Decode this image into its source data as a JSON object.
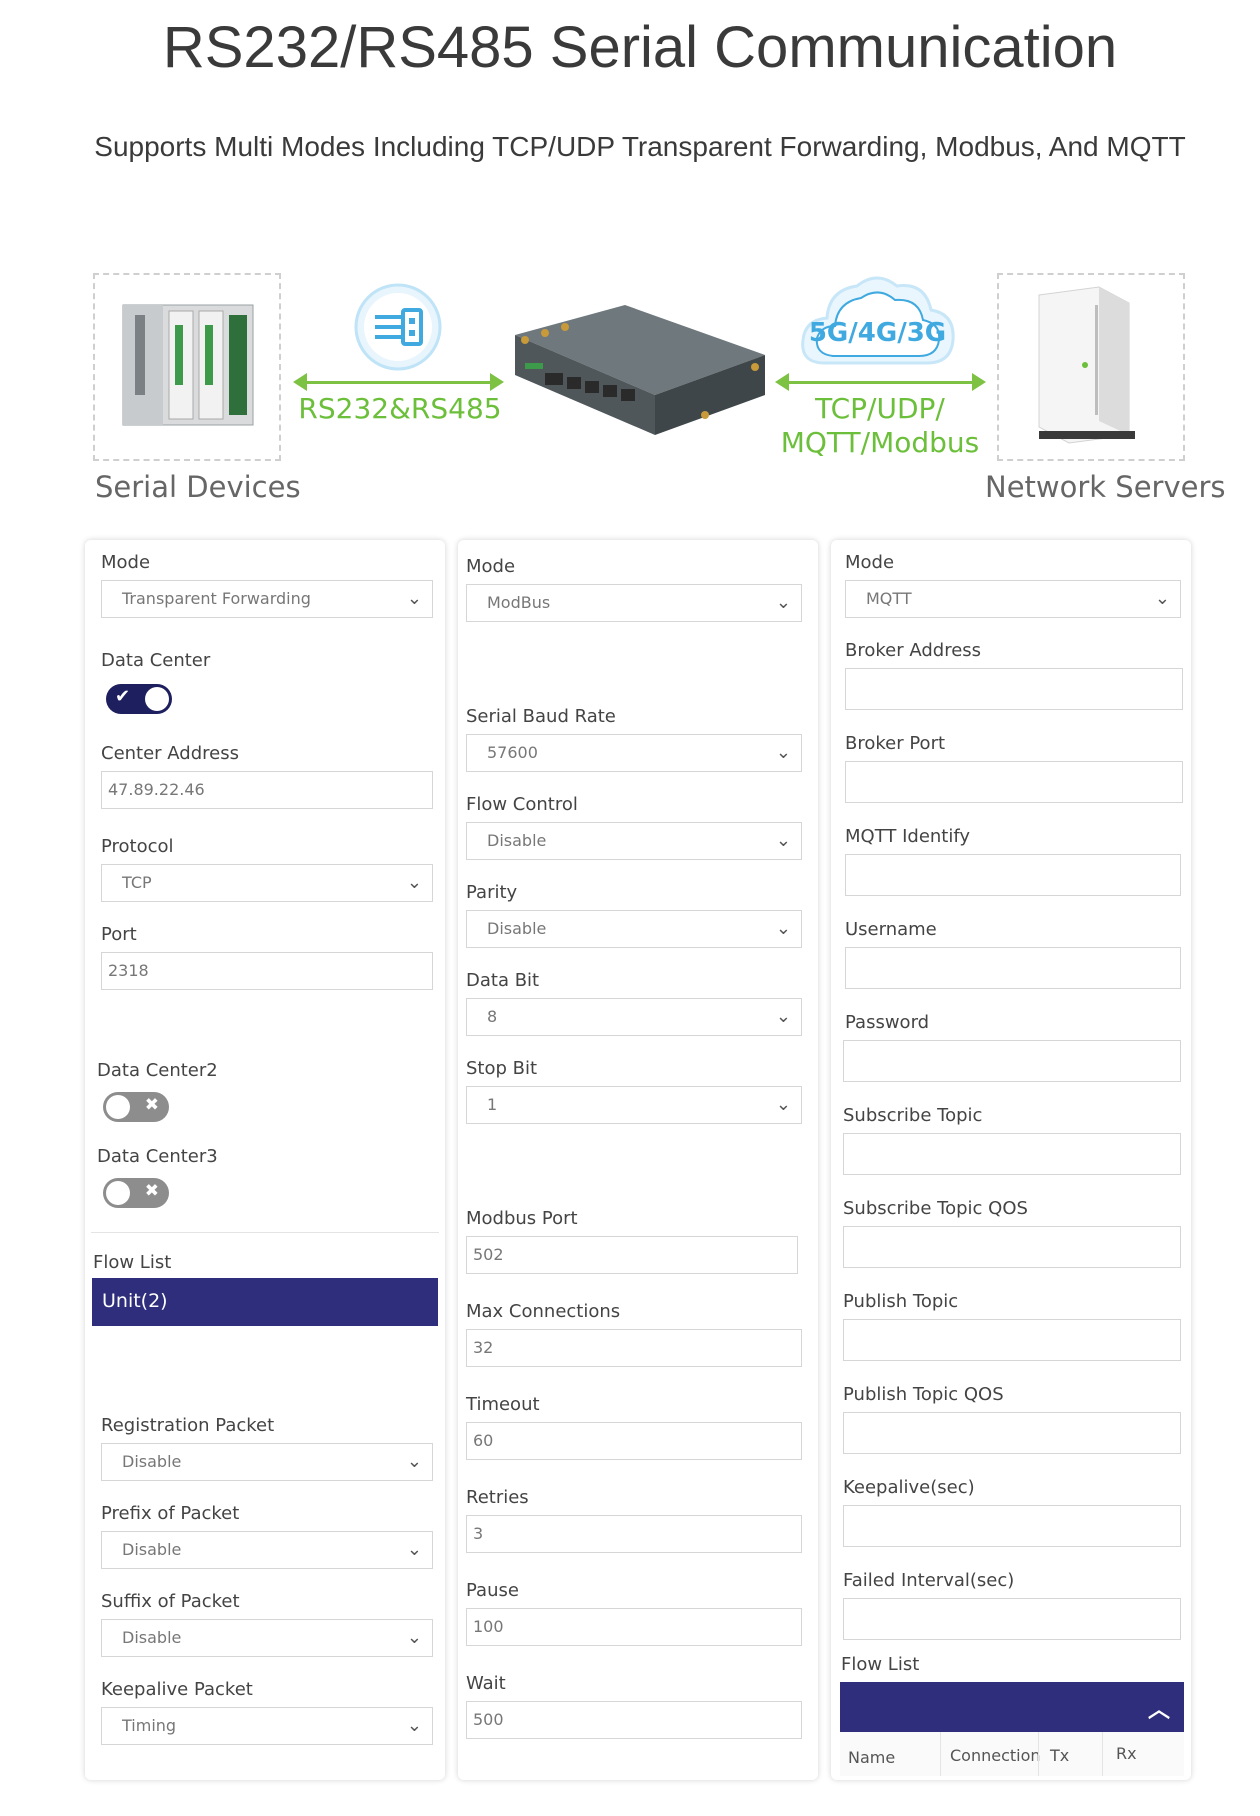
{
  "header": {
    "title": "RS232/RS485 Serial Communication",
    "subtitle": "Supports Multi Modes Including TCP/UDP Transparent Forwarding, Modbus, And MQTT"
  },
  "diagram": {
    "left_label": "Serial Devices",
    "right_label": "Network Servers",
    "left_link": "RS232&RS485",
    "cloud_label": "5G/4G/3G",
    "right_link_line1": "TCP/UDP/",
    "right_link_line2": "MQTT/Modbus",
    "colors": {
      "green": "#7dc243",
      "blue": "#3fa9e0",
      "navy": "#2e2e7c"
    }
  },
  "panel1": {
    "mode_label": "Mode",
    "mode_value": "Transparent Forwarding",
    "data_center_label": "Data Center",
    "center_address_label": "Center Address",
    "center_address_value": "47.89.22.46",
    "protocol_label": "Protocol",
    "protocol_value": "TCP",
    "port_label": "Port",
    "port_value": "2318",
    "data_center2_label": "Data Center2",
    "data_center3_label": "Data Center3",
    "flow_list_label": "Flow List",
    "unit_label": "Unit(2)",
    "registration_label": "Registration Packet",
    "registration_value": "Disable",
    "prefix_label": "Prefix of Packet",
    "prefix_value": "Disable",
    "suffix_label": "Suffix of Packet",
    "suffix_value": "Disable",
    "keepalive_label": "Keepalive Packet",
    "keepalive_value": "Timing"
  },
  "panel2": {
    "mode_label": "Mode",
    "mode_value": "ModBus",
    "baud_label": "Serial Baud Rate",
    "baud_value": "57600",
    "flow_label": "Flow Control",
    "flow_value": "Disable",
    "parity_label": "Parity",
    "parity_value": "Disable",
    "databit_label": "Data Bit",
    "databit_value": "8",
    "stopbit_label": "Stop Bit",
    "stopbit_value": "1",
    "modbus_port_label": "Modbus Port",
    "modbus_port_value": "502",
    "max_conn_label": "Max Connections",
    "max_conn_value": "32",
    "timeout_label": "Timeout",
    "timeout_value": "60",
    "retries_label": "Retries",
    "retries_value": "3",
    "pause_label": "Pause",
    "pause_value": "100",
    "wait_label": "Wait",
    "wait_value": "500"
  },
  "panel3": {
    "mode_label": "Mode",
    "mode_value": "MQTT",
    "broker_address_label": "Broker Address",
    "broker_port_label": "Broker Port",
    "mqtt_identify_label": "MQTT Identify",
    "username_label": "Username",
    "password_label": "Password",
    "subscribe_topic_label": "Subscribe Topic",
    "subscribe_qos_label": "Subscribe Topic QOS",
    "publish_topic_label": "Publish Topic",
    "publish_qos_label": "Publish Topic QOS",
    "keepalive_label": "Keepalive(sec)",
    "failed_interval_label": "Failed Interval(sec)",
    "flow_list_label": "Flow List",
    "columns": [
      "Name",
      "Connection",
      "Tx",
      "Rx"
    ]
  }
}
